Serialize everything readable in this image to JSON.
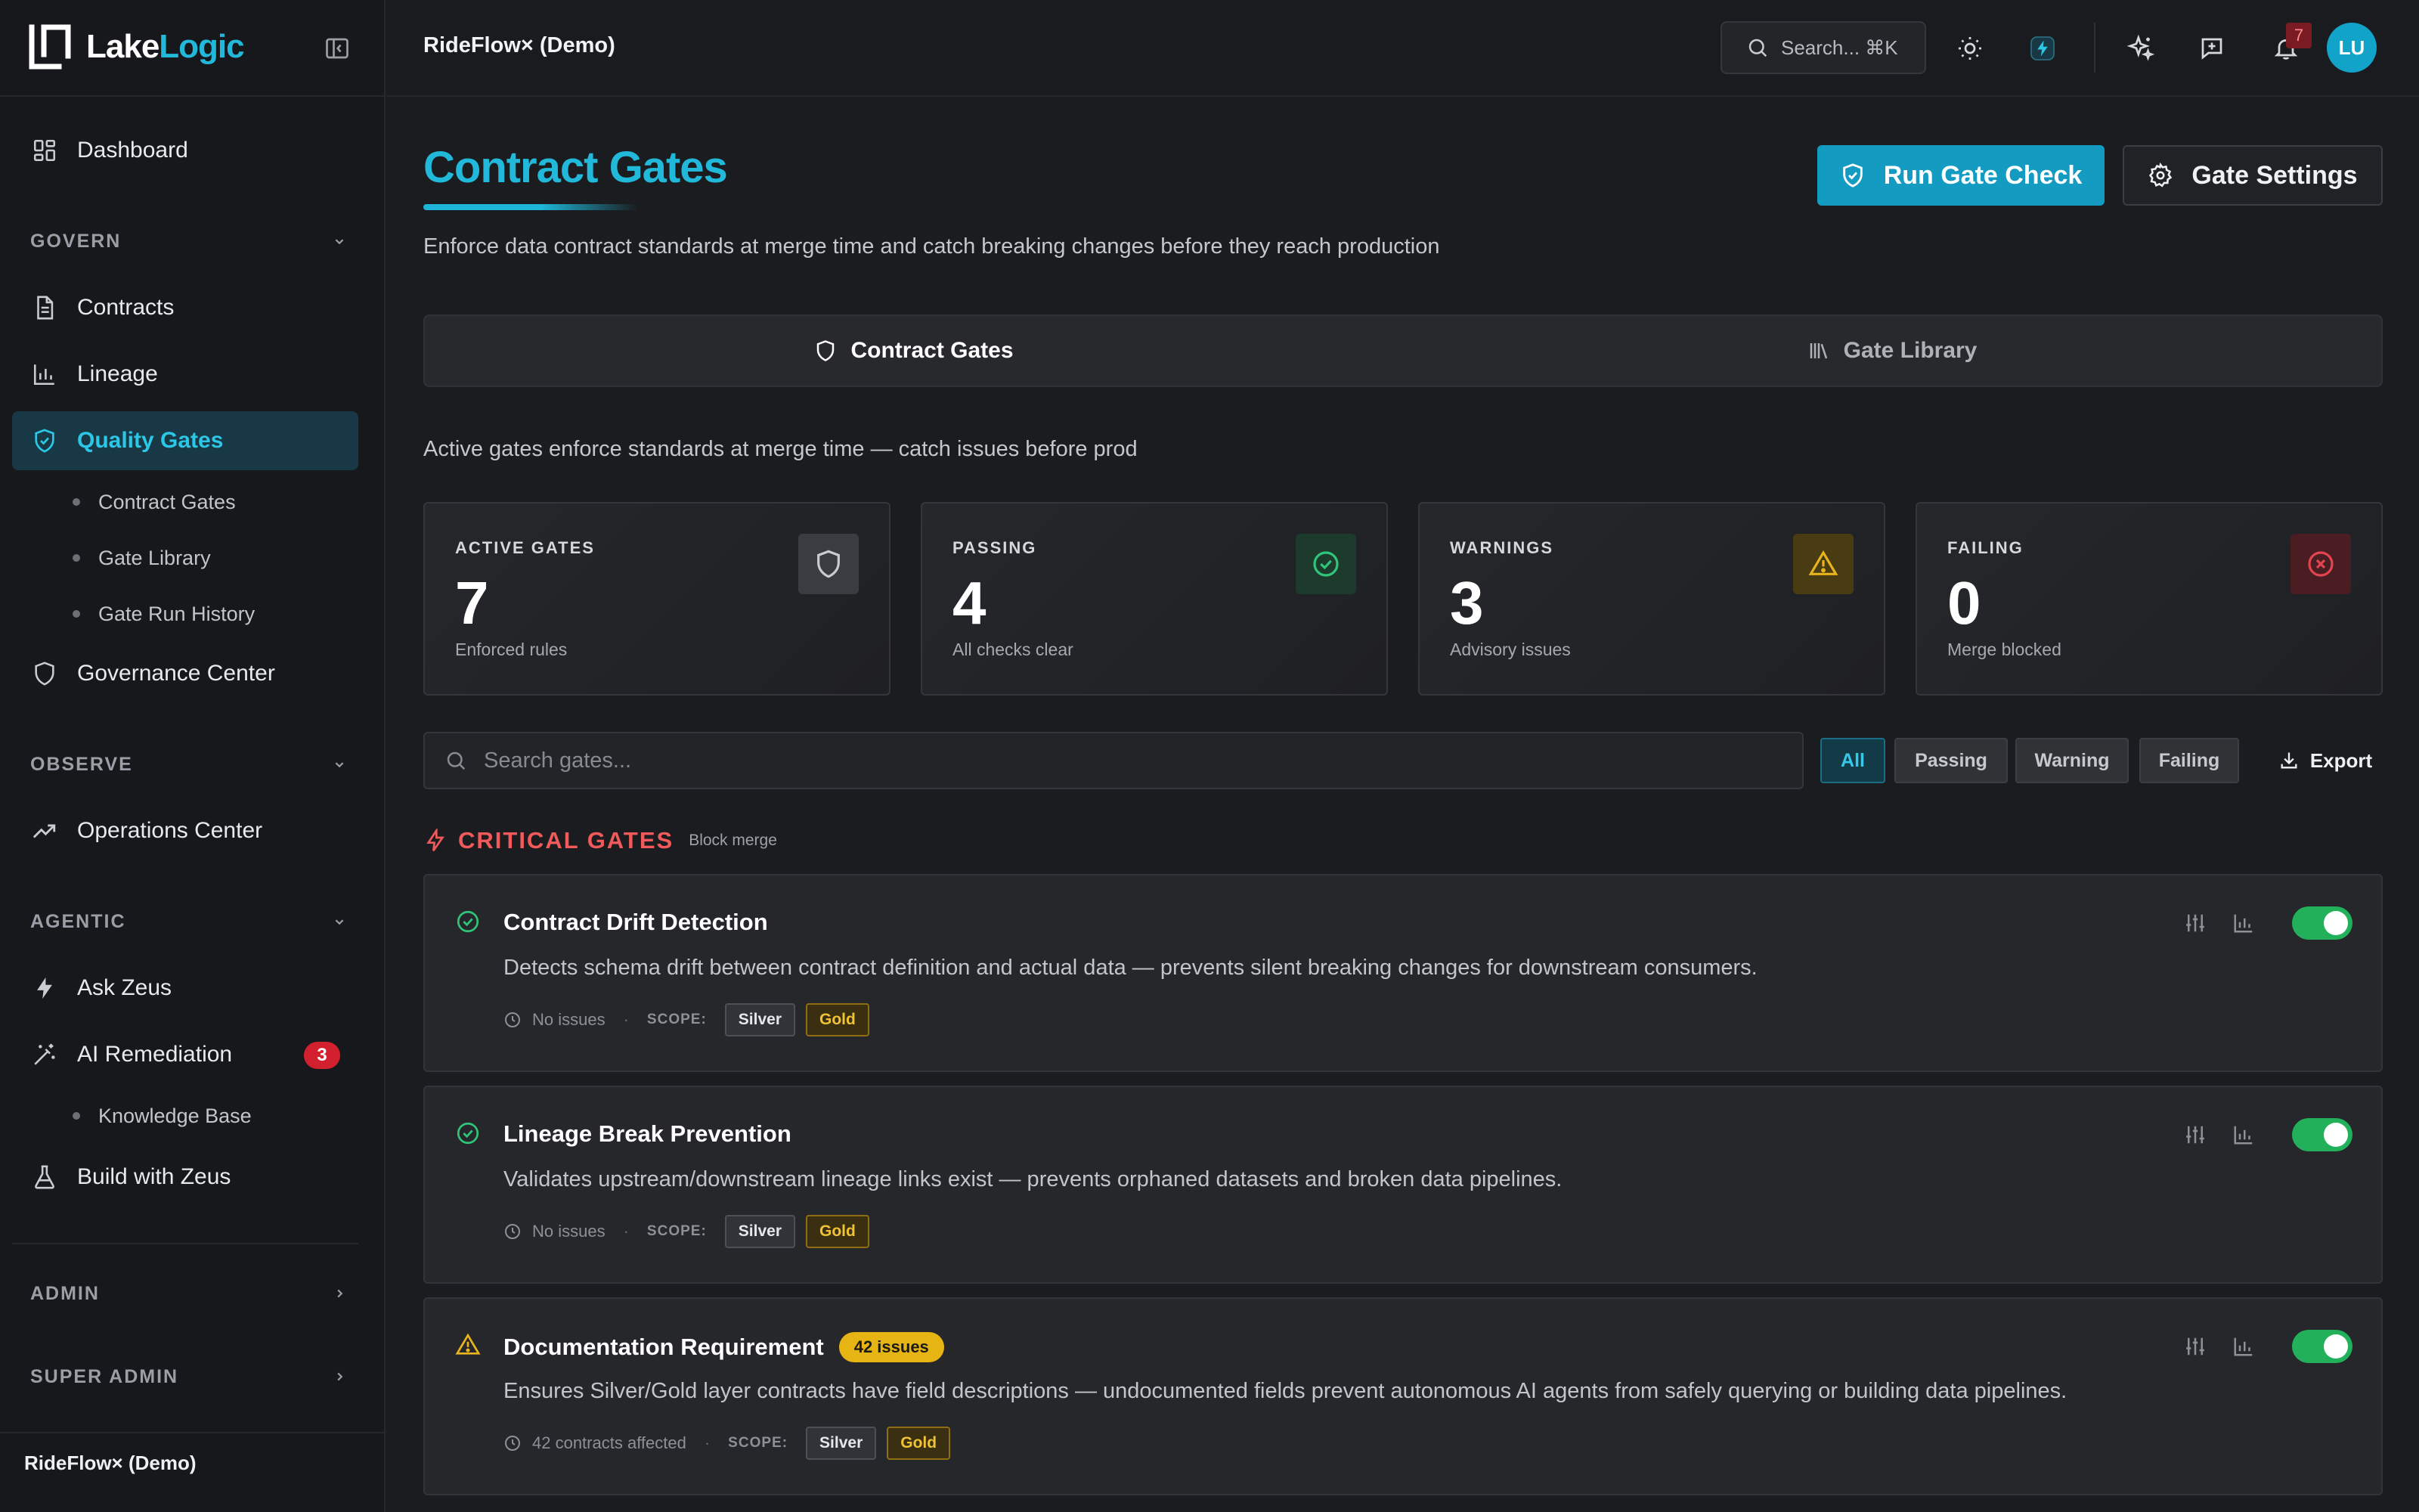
{
  "brand": {
    "part1": "Lake",
    "part2": "Logic"
  },
  "sidebar": {
    "dashboard": "Dashboard",
    "sections": {
      "govern": "GOVERN",
      "observe": "OBSERVE",
      "agentic": "AGENTIC",
      "admin": "ADMIN",
      "super_admin": "SUPER ADMIN"
    },
    "items": {
      "contracts": "Contracts",
      "lineage": "Lineage",
      "quality_gates": "Quality Gates",
      "governance_center": "Governance Center",
      "operations_center": "Operations Center",
      "ask_zeus": "Ask Zeus",
      "ai_remediation": "AI Remediation",
      "ai_remediation_badge": "3",
      "build_with_zeus": "Build with Zeus"
    },
    "sub_items": {
      "contract_gates": "Contract Gates",
      "gate_library": "Gate Library",
      "gate_run_history": "Gate Run History",
      "knowledge_base": "Knowledge Base"
    },
    "footer_org": "RideFlow× (Demo)"
  },
  "topbar": {
    "workspace": "RideFlow× (Demo)",
    "search_placeholder": "Search... ⌘K",
    "notification_count": "7",
    "avatar_initials": "LU"
  },
  "page": {
    "title": "Contract Gates",
    "description": "Enforce data contract standards at merge time and catch breaking changes before they reach production",
    "run_button": "Run Gate Check",
    "settings_button": "Gate Settings",
    "tabs": [
      "Contract Gates",
      "Gate Library"
    ],
    "sub_description": "Active gates enforce standards at merge time — catch issues before prod"
  },
  "stats": [
    {
      "label": "ACTIVE GATES",
      "value": "7",
      "sub": "Enforced rules",
      "icon": "shield-icon",
      "color": "#c9ccd1"
    },
    {
      "label": "PASSING",
      "value": "4",
      "sub": "All checks clear",
      "icon": "check-circle-icon",
      "color": "#2fc57a"
    },
    {
      "label": "WARNINGS",
      "value": "3",
      "sub": "Advisory issues",
      "icon": "warning-icon",
      "color": "#e8b51c"
    },
    {
      "label": "FAILING",
      "value": "0",
      "sub": "Merge blocked",
      "icon": "x-circle-icon",
      "color": "#e2454f"
    }
  ],
  "filters": {
    "search_placeholder": "Search gates...",
    "options": [
      "All",
      "Passing",
      "Warning",
      "Failing"
    ],
    "active": "All",
    "export": "Export"
  },
  "group": {
    "title": "CRITICAL GATES",
    "subtitle": "Block merge"
  },
  "scope_label": "SCOPE:",
  "gates": [
    {
      "name": "Contract Drift Detection",
      "status": "passing",
      "issues_badge": "",
      "description": "Detects schema drift between contract definition and actual data — prevents silent breaking changes for downstream consumers.",
      "meta": "No issues",
      "scopes": [
        "Silver",
        "Gold"
      ],
      "enabled": true
    },
    {
      "name": "Lineage Break Prevention",
      "status": "passing",
      "issues_badge": "",
      "description": "Validates upstream/downstream lineage links exist — prevents orphaned datasets and broken data pipelines.",
      "meta": "No issues",
      "scopes": [
        "Silver",
        "Gold"
      ],
      "enabled": true
    },
    {
      "name": "Documentation Requirement",
      "status": "warning",
      "issues_badge": "42 issues",
      "description": "Ensures Silver/Gold layer contracts have field descriptions — undocumented fields prevent autonomous AI agents from safely querying or building data pipelines.",
      "meta": "42 contracts affected",
      "scopes": [
        "Silver",
        "Gold"
      ],
      "enabled": true
    }
  ],
  "colors": {
    "accent": "#22b8d9",
    "primary_button": "#139bc2",
    "critical": "#f05a5a",
    "toggle_on": "#22b05a"
  }
}
